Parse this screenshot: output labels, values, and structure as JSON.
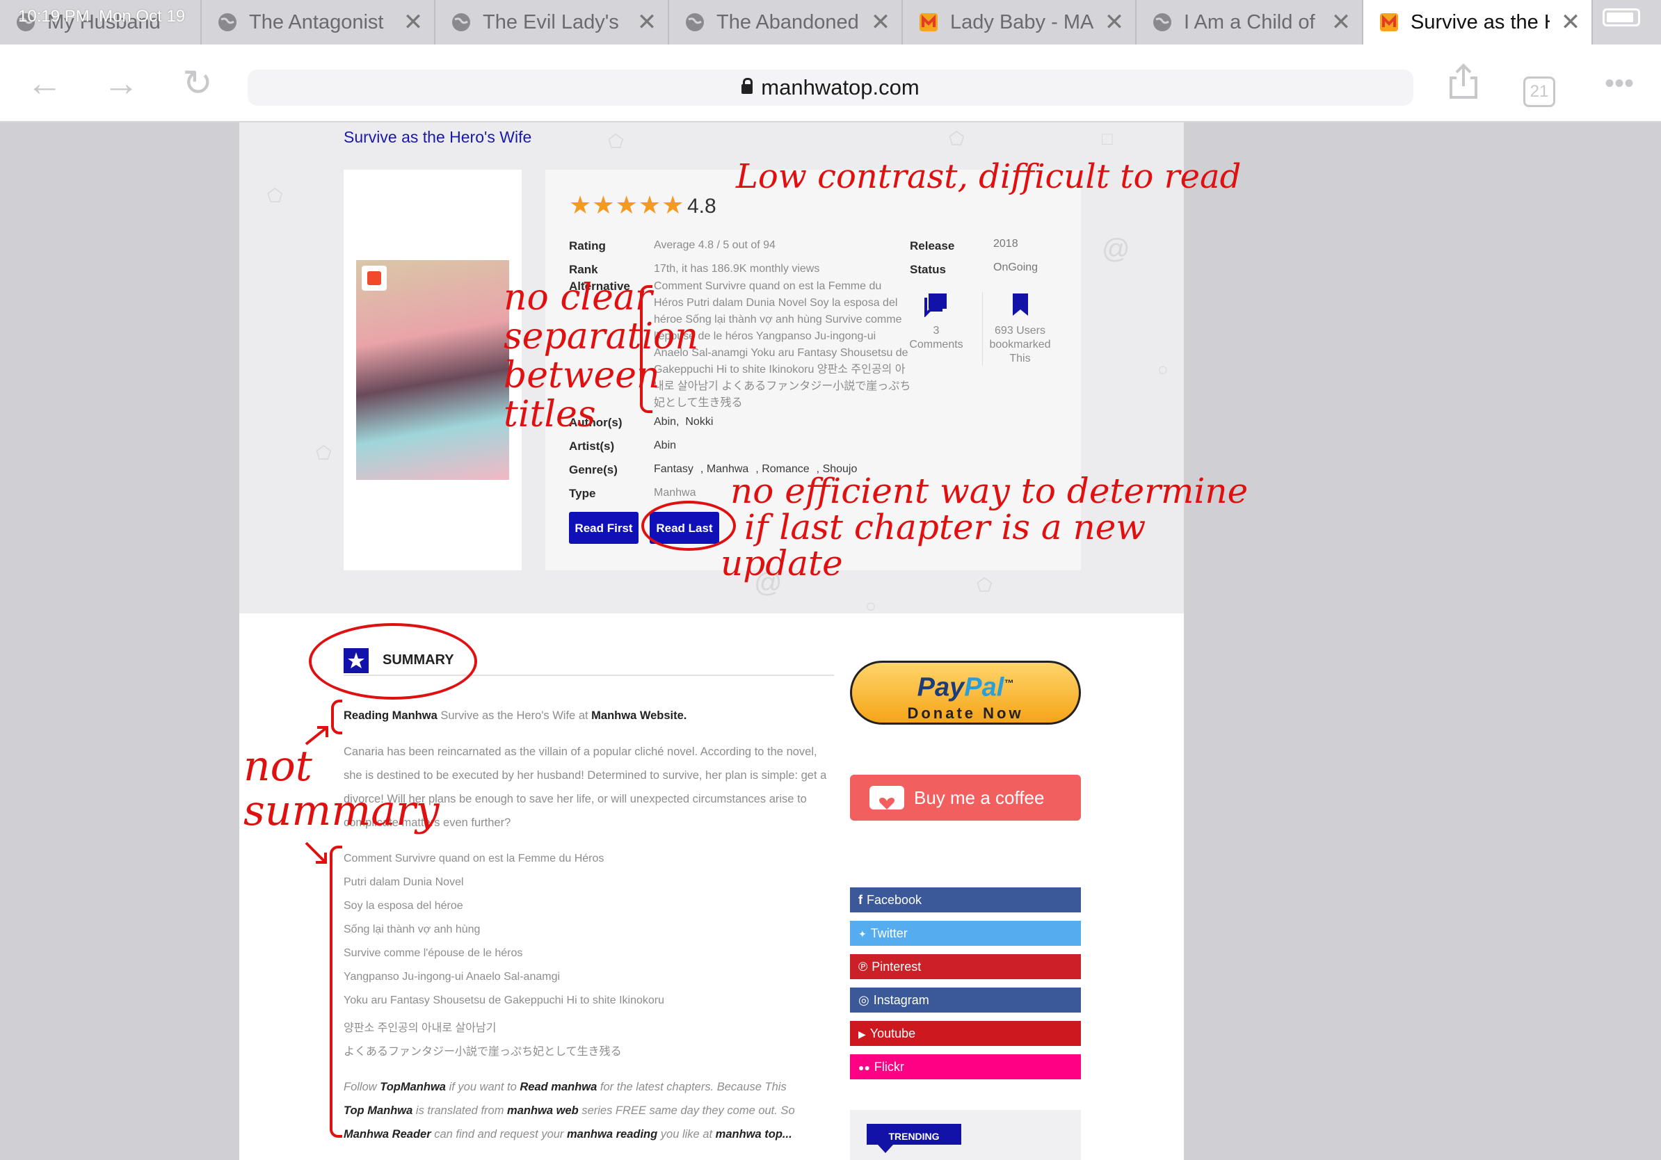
{
  "status": {
    "time": "10:19 PM",
    "date": "Mon Oct 19"
  },
  "tabs": [
    {
      "title": "My Husband",
      "icon": "globe-icon"
    },
    {
      "title": "The Antagonist",
      "icon": "globe-icon"
    },
    {
      "title": "The Evil Lady's",
      "icon": "globe-icon"
    },
    {
      "title": "The Abandoned",
      "icon": "globe-icon"
    },
    {
      "title": "Lady Baby - MA",
      "icon": "manhwa-logo-icon"
    },
    {
      "title": "I Am a Child of",
      "icon": "globe-icon"
    },
    {
      "title": "Survive as the H",
      "icon": "manhwa-logo-icon"
    }
  ],
  "browser": {
    "url": "manhwatop.com",
    "tab_count": "21"
  },
  "breadcrumb": "Survive as the Hero's Wife",
  "rating": {
    "stars": "★★★★★",
    "value": "4.8"
  },
  "info": {
    "rating_label": "Rating",
    "rating_value": "Average 4.8 / 5 out of 94",
    "rank_label": "Rank",
    "rank_value": "17th, it has 186.9K monthly views",
    "alt_label": "Alternative",
    "alt_value": "Comment Survivre quand on est la Femme du Héros Putri dalam Dunia Novel Soy la esposa del héroe Sống lại thành vợ anh hùng Survive comme l'épouse de le héros Yangpanso Ju-ingong-ui Anaelo Sal-anamgi Yoku aru Fantasy Shousetsu de Gakeppuchi Hi to shite Ikinokoru 양판소 주인공의 아내로 살아남기 よくあるファンタジー小説で崖っぷち妃として生き残る",
    "author_label": "Author(s)",
    "authors": [
      "Abin",
      "Nokki"
    ],
    "artist_label": "Artist(s)",
    "artist_value": "Abin",
    "genre_label": "Genre(s)",
    "genres": [
      "Fantasy",
      "Manhwa",
      "Romance",
      "Shoujo"
    ],
    "type_label": "Type",
    "type_value": "Manhwa",
    "release_label": "Release",
    "release_value": "2018",
    "status_label": "Status",
    "status_value": "OnGoing",
    "comments_count": "3",
    "comments_label": "Comments",
    "bookmark_line1": "693 Users",
    "bookmark_line2": "bookmarked",
    "bookmark_line3": "This"
  },
  "buttons": {
    "read_first": "Read First",
    "read_last": "Read Last"
  },
  "summary": {
    "title": "SUMMARY",
    "intro_b1": "Reading Manhwa",
    "intro_mid": " Survive as the Hero's Wife at ",
    "intro_b2": "Manhwa Website.",
    "body": "Canaria has been reincarnated as the villain of a popular cliché novel. According to the novel, she is destined to be executed by her husband! Determined to survive, her plan is simple: get a divorce! Will her plans be enough to save her life, or will unexpected circumstances arise to complicate matters even further?",
    "alt_titles": [
      "Comment Survivre quand on est la Femme du Héros",
      "Putri dalam Dunia Novel",
      "Soy la esposa del héroe",
      "Sống lại thành vợ anh hùng",
      "Survive comme l'épouse de le héros",
      "Yangpanso Ju-ingong-ui Anaelo Sal-anamgi",
      "Yoku aru Fantasy Shousetsu de Gakeppuchi Hi to shite Ikinokoru",
      "양판소 주인공의 아내로 살아남기",
      "よくあるファンタジー小説で崖っぷち妃として生き残る"
    ],
    "follow_1": "Follow ",
    "follow_b1": "TopManhwa",
    "follow_2": " if you want to ",
    "follow_b2": "Read manhwa",
    "follow_3": "  for the latest chapters. Because This",
    "follow_b3": "Top Manhwa",
    "follow_4": " is translated from ",
    "follow_b4": "manhwa web",
    "follow_5": " series FREE same day they come out. So",
    "follow_b5": "Manhwa Reader",
    "follow_6": " can find and request your ",
    "follow_b6": "manhwa reading",
    "follow_7": " you like at ",
    "follow_b7": "manhwa top..."
  },
  "sidebar": {
    "paypal_brand_1": "Pay",
    "paypal_brand_2": "Pal",
    "paypal_tm": "™",
    "paypal_cta": "Donate Now",
    "coffee": "Buy me a coffee",
    "social": [
      {
        "label": "Facebook",
        "color": "#3b5998",
        "glyph": "f"
      },
      {
        "label": "Twitter",
        "color": "#55acee",
        "glyph": "🐦"
      },
      {
        "label": "Pinterest",
        "color": "#cb2027",
        "glyph": "℗"
      },
      {
        "label": "Instagram",
        "color": "#3b5998",
        "glyph": "◎"
      },
      {
        "label": "Youtube",
        "color": "#cc181e",
        "glyph": "▶"
      },
      {
        "label": "Flickr",
        "color": "#ff0084",
        "glyph": "●"
      }
    ],
    "trending": "TRENDING"
  },
  "annotations": {
    "contrast": "Low contrast, difficult to read",
    "separation": [
      "no clear",
      "separation",
      "between",
      "titles"
    ],
    "efficient": [
      "no efficient way to determine",
      "if last chapter is a new",
      "update"
    ],
    "not_summary": [
      "not",
      "summary"
    ]
  },
  "colors": {
    "accent": "#1010b8",
    "star": "#f39a1f",
    "annotation": "#e01010"
  }
}
